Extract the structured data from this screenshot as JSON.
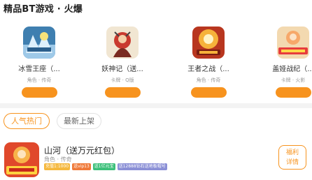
{
  "section": {
    "title": "精品BT游戏 · 火爆"
  },
  "featured_games": [
    {
      "name": "冰雪王座（...",
      "tags": "角色 · 传奇",
      "icon": "ice-throne-game-icon"
    },
    {
      "name": "妖神记（送...",
      "tags": "卡牌 · Q版",
      "icon": "demon-god-game-icon"
    },
    {
      "name": "王者之战（...",
      "tags": "角色 · 传奇",
      "icon": "war-of-kings-game-icon"
    },
    {
      "name": "盖娅战纪（...",
      "tags": "卡牌 · 火影",
      "icon": "gaia-saga-game-icon"
    }
  ],
  "tabs": [
    {
      "label": "人气热门",
      "active": true
    },
    {
      "label": "最新上架",
      "active": false
    }
  ],
  "list": [
    {
      "title": "山河（送万元红包）",
      "tags": "角色 · 传奇",
      "icon": "shanhe-game-icon",
      "badges": [
        {
          "text": "充值1:1000",
          "color": "#f5b83d"
        },
        {
          "text": "送vip13",
          "color": "#f07a3a"
        },
        {
          "text": "送1亿元宝",
          "color": "#3cc07a"
        },
        {
          "text": "送12888钻石送地板帽号",
          "color": "#8a8fd6"
        }
      ],
      "button_line1": "福利",
      "button_line2": "详情"
    }
  ],
  "colors": {
    "accent": "#f7931e",
    "divider": "#f3f3f3"
  }
}
